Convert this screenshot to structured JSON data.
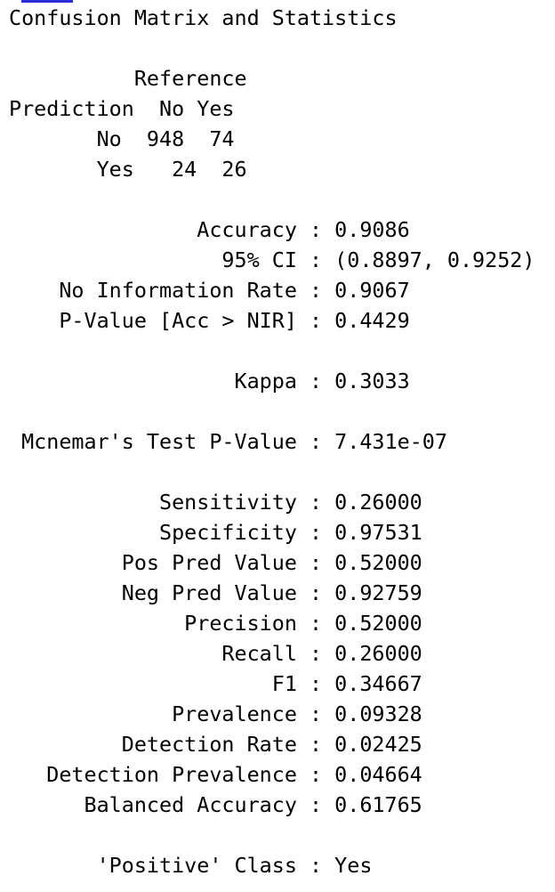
{
  "title": "Confusion Matrix and Statistics",
  "matrix": {
    "reference_header": "Reference",
    "prediction_label": "Prediction",
    "col_no": "No",
    "col_yes": "Yes",
    "rows": [
      {
        "label": "No",
        "no": "948",
        "yes": "74"
      },
      {
        "label": "Yes",
        "no": "24",
        "yes": "26"
      }
    ]
  },
  "stats_group1": [
    {
      "label": "Accuracy",
      "value": "0.9086"
    },
    {
      "label": "95% CI",
      "value": "(0.8897, 0.9252)"
    },
    {
      "label": "No Information Rate",
      "value": "0.9067"
    },
    {
      "label": "P-Value [Acc > NIR]",
      "value": "0.4429"
    }
  ],
  "kappa": {
    "label": "Kappa",
    "value": "0.3033"
  },
  "mcnemar": {
    "label": "Mcnemar's Test P-Value",
    "value": "7.431e-07"
  },
  "stats_group2": [
    {
      "label": "Sensitivity",
      "value": "0.26000"
    },
    {
      "label": "Specificity",
      "value": "0.97531"
    },
    {
      "label": "Pos Pred Value",
      "value": "0.52000"
    },
    {
      "label": "Neg Pred Value",
      "value": "0.92759"
    },
    {
      "label": "Precision",
      "value": "0.52000"
    },
    {
      "label": "Recall",
      "value": "0.26000"
    },
    {
      "label": "F1",
      "value": "0.34667"
    },
    {
      "label": "Prevalence",
      "value": "0.09328"
    },
    {
      "label": "Detection Rate",
      "value": "0.02425"
    },
    {
      "label": "Detection Prevalence",
      "value": "0.04664"
    },
    {
      "label": "Balanced Accuracy",
      "value": "0.61765"
    }
  ],
  "positive_class": {
    "label": "'Positive' Class",
    "value": "Yes"
  },
  "colors": {
    "text": "#000000",
    "background": "#ffffff",
    "top_sliver": "#2b2bd9"
  }
}
